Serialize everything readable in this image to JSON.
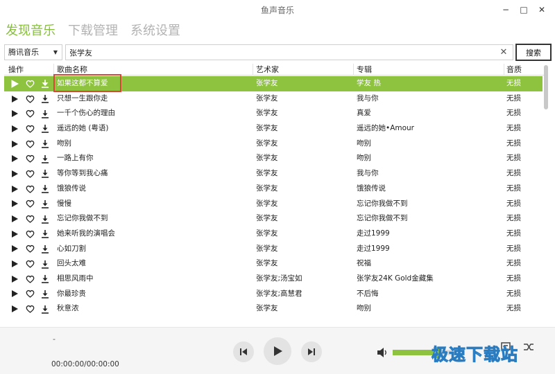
{
  "window": {
    "title": "鱼声音乐",
    "minimize": "−",
    "maximize": "□",
    "close": "✕"
  },
  "nav": {
    "tabs": [
      "发现音乐",
      "下载管理",
      "系统设置"
    ],
    "active": 0
  },
  "search": {
    "source": "腾讯音乐",
    "query": "张学友",
    "button": "搜索"
  },
  "table": {
    "headers": {
      "ops": "操作",
      "song": "歌曲名称",
      "artist": "艺术家",
      "album": "专辑",
      "quality": "音质"
    },
    "rows": [
      {
        "song": "如果这都不算爱",
        "artist": "张学友",
        "album": "学友 热",
        "quality": "无损"
      },
      {
        "song": "只想一生跟你走",
        "artist": "张学友",
        "album": "我与你",
        "quality": "无损"
      },
      {
        "song": "一千个伤心的理由",
        "artist": "张学友",
        "album": "真爱",
        "quality": "无损"
      },
      {
        "song": "遥远的她 (粤语)",
        "artist": "张学友",
        "album": "遥远的她•Amour",
        "quality": "无损"
      },
      {
        "song": "吻别",
        "artist": "张学友",
        "album": "吻别",
        "quality": "无损"
      },
      {
        "song": "一路上有你",
        "artist": "张学友",
        "album": "吻别",
        "quality": "无损"
      },
      {
        "song": "等你等到我心痛",
        "artist": "张学友",
        "album": "我与你",
        "quality": "无损"
      },
      {
        "song": "饿狼传说",
        "artist": "张学友",
        "album": "饿狼传说",
        "quality": "无损"
      },
      {
        "song": "慢慢",
        "artist": "张学友",
        "album": "忘记你我做不到",
        "quality": "无损"
      },
      {
        "song": "忘记你我做不到",
        "artist": "张学友",
        "album": "忘记你我做不到",
        "quality": "无损"
      },
      {
        "song": "她来听我的演唱会",
        "artist": "张学友",
        "album": "走过1999",
        "quality": "无损"
      },
      {
        "song": "心如刀割",
        "artist": "张学友",
        "album": "走过1999",
        "quality": "无损"
      },
      {
        "song": "回头太难",
        "artist": "张学友",
        "album": "祝福",
        "quality": "无损"
      },
      {
        "song": "相思风雨中",
        "artist": "张学友;汤宝如",
        "album": "张学友24K Gold金藏集",
        "quality": "无损"
      },
      {
        "song": "你最珍贵",
        "artist": "张学友;高慧君",
        "album": "不后悔",
        "quality": "无损"
      },
      {
        "song": "秋意浓",
        "artist": "张学友",
        "album": "吻别",
        "quality": "无损"
      }
    ]
  },
  "player": {
    "now_playing": "-",
    "time": "00:00:00/00:00:00",
    "volume_percent": 70
  },
  "colors": {
    "accent": "#8ec33f",
    "nav_active": "#86bf3c",
    "highlight": "#d9453a"
  },
  "watermark": "极速下载站"
}
